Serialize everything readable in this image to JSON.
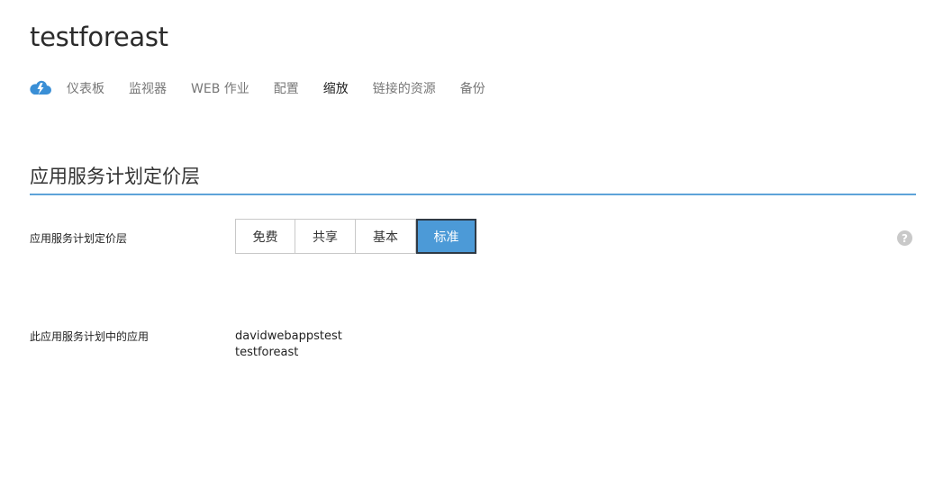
{
  "site": {
    "title": "testforeast"
  },
  "nav": {
    "icon": "cloud-lightning-icon",
    "items": [
      {
        "label": "仪表板",
        "active": false
      },
      {
        "label": "监视器",
        "active": false
      },
      {
        "label": "WEB 作业",
        "active": false
      },
      {
        "label": "配置",
        "active": false
      },
      {
        "label": "缩放",
        "active": true
      },
      {
        "label": "链接的资源",
        "active": false
      },
      {
        "label": "备份",
        "active": false
      }
    ]
  },
  "section": {
    "title": "应用服务计划定价层"
  },
  "tier": {
    "label": "应用服务计划定价层",
    "options": [
      "免费",
      "共享",
      "基本",
      "标准"
    ],
    "selected": "标准",
    "help_glyph": "?"
  },
  "apps": {
    "label": "此应用服务计划中的应用",
    "items": [
      "davidwebappstest",
      "testforeast"
    ]
  },
  "colors": {
    "accent": "#4c9ad7",
    "rule": "#5ea3d9",
    "icon_blue": "#3a8fd6"
  }
}
